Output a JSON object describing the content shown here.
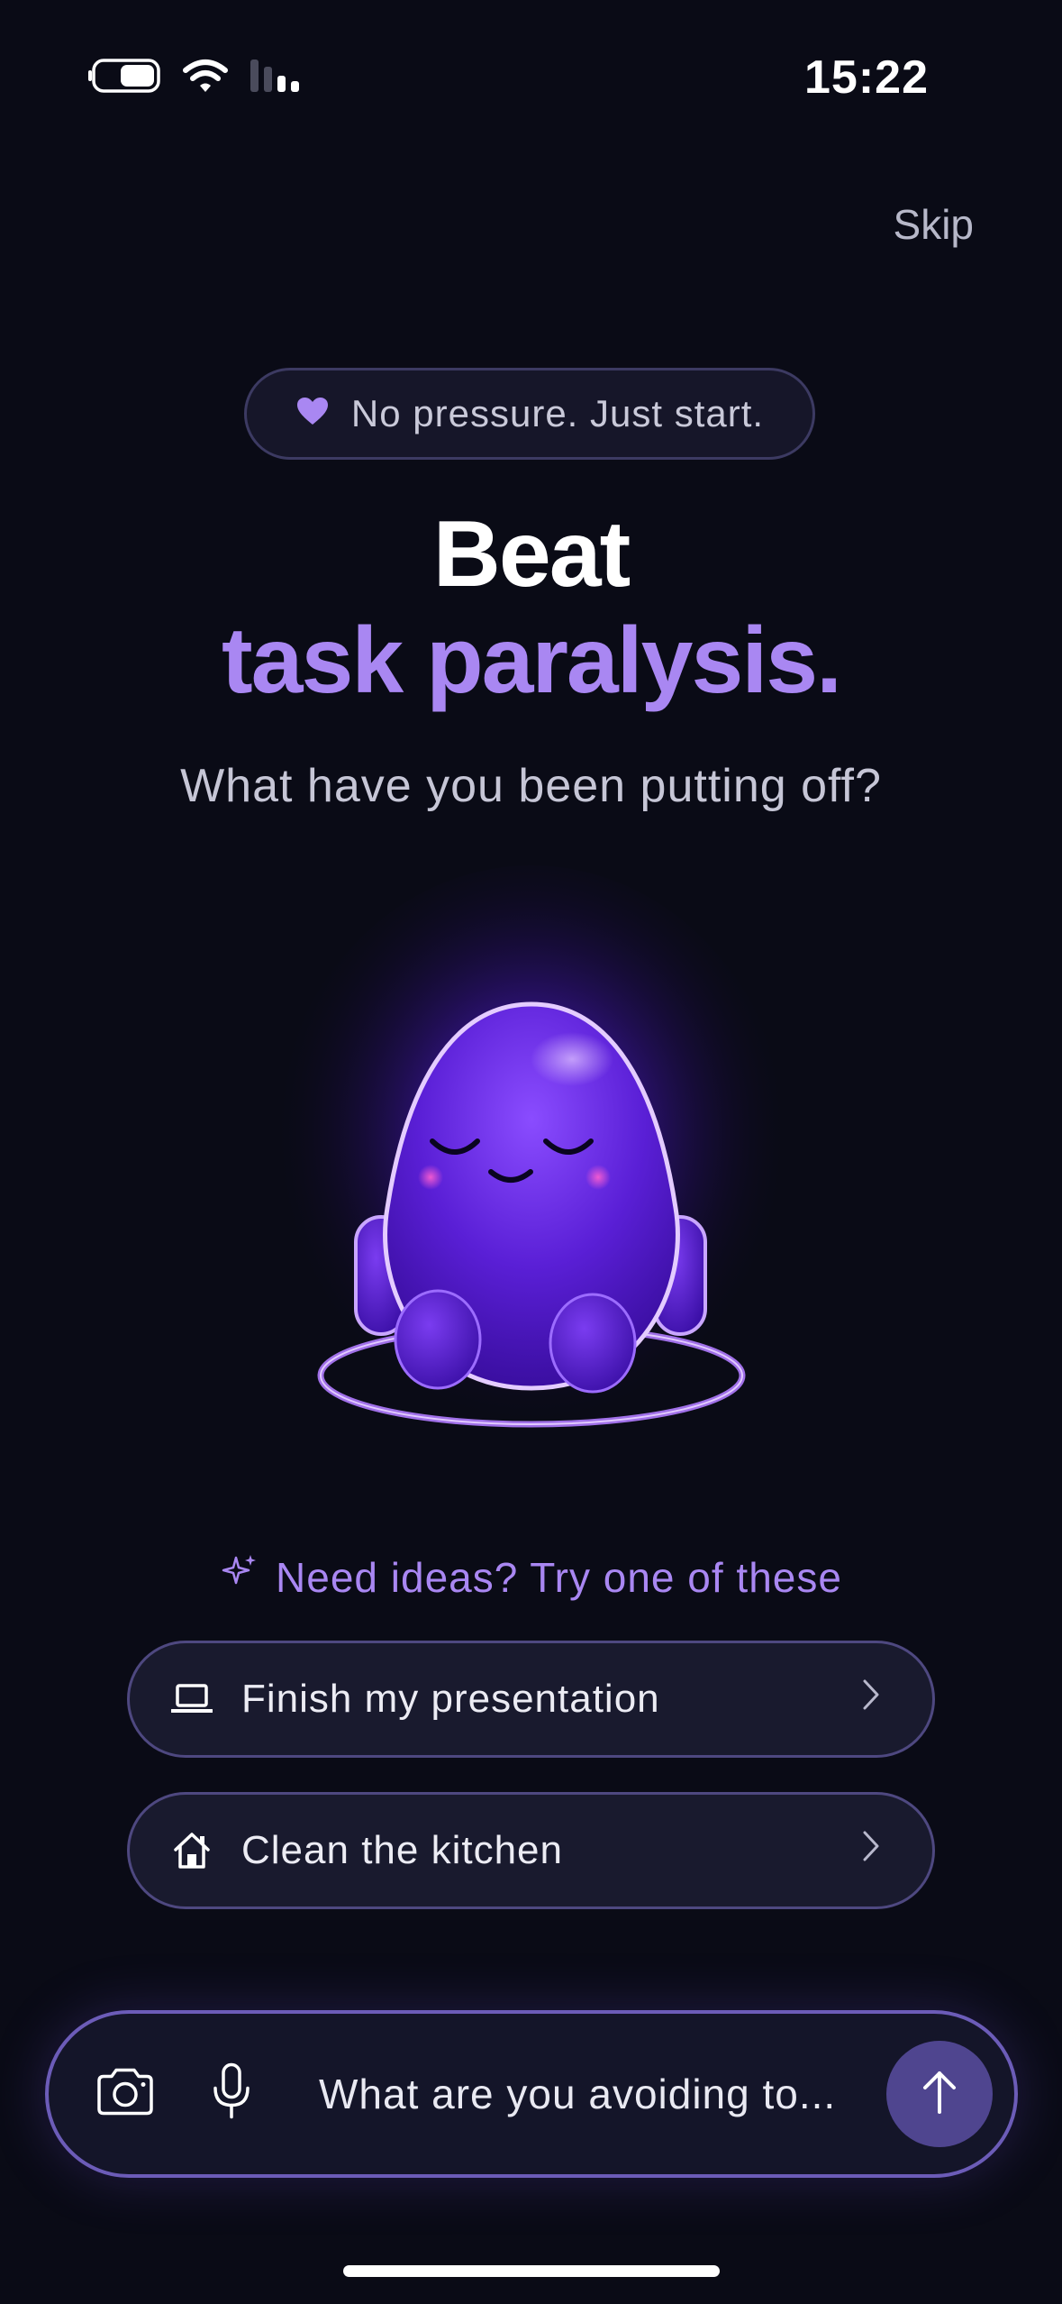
{
  "status_bar": {
    "time": "15:22",
    "icons": [
      "battery-icon",
      "wifi-icon",
      "signal-icon"
    ]
  },
  "header": {
    "skip_label": "Skip"
  },
  "badge": {
    "icon": "heart-icon",
    "text": "No pressure. Just start."
  },
  "hero": {
    "title_line_1": "Beat",
    "title_line_2": "task paralysis.",
    "subtitle": "What have you been putting off?"
  },
  "ideas": {
    "icon": "sparkle-icon",
    "heading": "Need ideas? Try one of these",
    "suggestions": [
      {
        "icon": "laptop-icon",
        "label": "Finish my presentation"
      },
      {
        "icon": "home-icon",
        "label": "Clean the kitchen"
      }
    ]
  },
  "composer": {
    "placeholder": "What are you avoiding to...",
    "icons": [
      "camera-icon",
      "microphone-icon",
      "arrow-up-icon"
    ]
  },
  "colors": {
    "background": "#0a0b16",
    "accent": "#a987f2",
    "mascot": "#5a1fd6"
  }
}
